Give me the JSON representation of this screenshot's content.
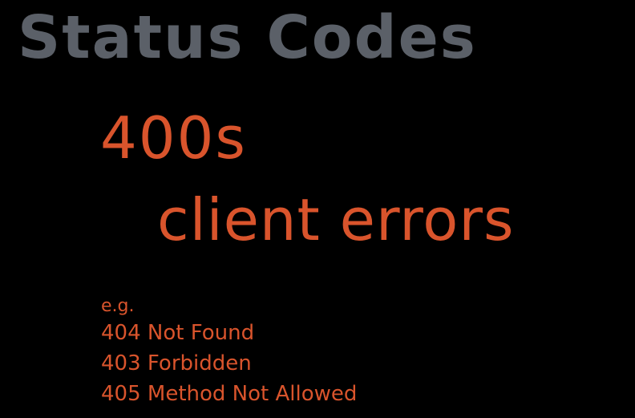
{
  "slide": {
    "title": "Status Codes",
    "code_range": "400s",
    "category": "client errors",
    "examples_label": "e.g.",
    "examples": [
      "404 Not Found",
      "403 Forbidden",
      "405 Method Not Allowed"
    ]
  },
  "colors": {
    "background": "#000000",
    "title": "#5b6068",
    "accent": "#d9542c"
  }
}
